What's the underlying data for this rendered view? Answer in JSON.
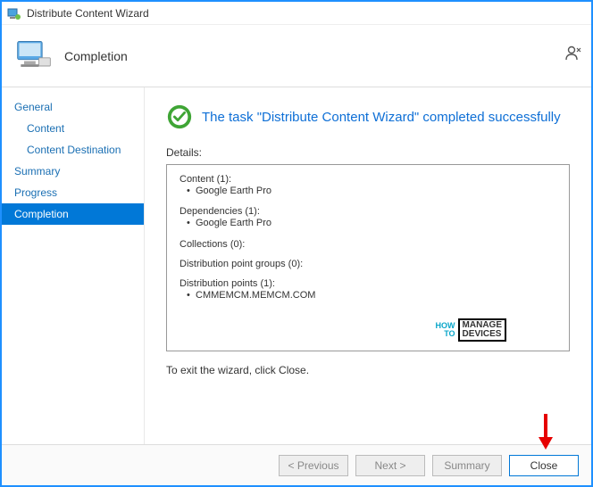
{
  "window": {
    "title": "Distribute Content Wizard"
  },
  "header": {
    "title": "Completion"
  },
  "sidebar": {
    "items": [
      {
        "label": "General",
        "indent": false,
        "active": false
      },
      {
        "label": "Content",
        "indent": true,
        "active": false
      },
      {
        "label": "Content Destination",
        "indent": true,
        "active": false
      },
      {
        "label": "Summary",
        "indent": false,
        "active": false
      },
      {
        "label": "Progress",
        "indent": false,
        "active": false
      },
      {
        "label": "Completion",
        "indent": false,
        "active": true
      }
    ]
  },
  "main": {
    "success_message": "The task \"Distribute Content Wizard\" completed successfully",
    "details_label": "Details:",
    "details": {
      "content": {
        "heading": "Content (1):",
        "items": [
          "Google Earth Pro"
        ]
      },
      "dependencies": {
        "heading": "Dependencies (1):",
        "items": [
          "Google Earth Pro"
        ]
      },
      "collections": {
        "heading": "Collections (0):",
        "items": []
      },
      "dpg": {
        "heading": "Distribution point groups (0):",
        "items": []
      },
      "dp": {
        "heading": "Distribution points (1):",
        "items": [
          "CMMEMCM.MEMCM.COM"
        ]
      }
    },
    "exit_text": "To exit the wizard, click Close."
  },
  "footer": {
    "previous": "< Previous",
    "next": "Next >",
    "summary": "Summary",
    "close": "Close"
  },
  "watermark": {
    "how": "HOW",
    "to": "TO",
    "manage": "MANAGE",
    "devices": "DEVICES"
  }
}
